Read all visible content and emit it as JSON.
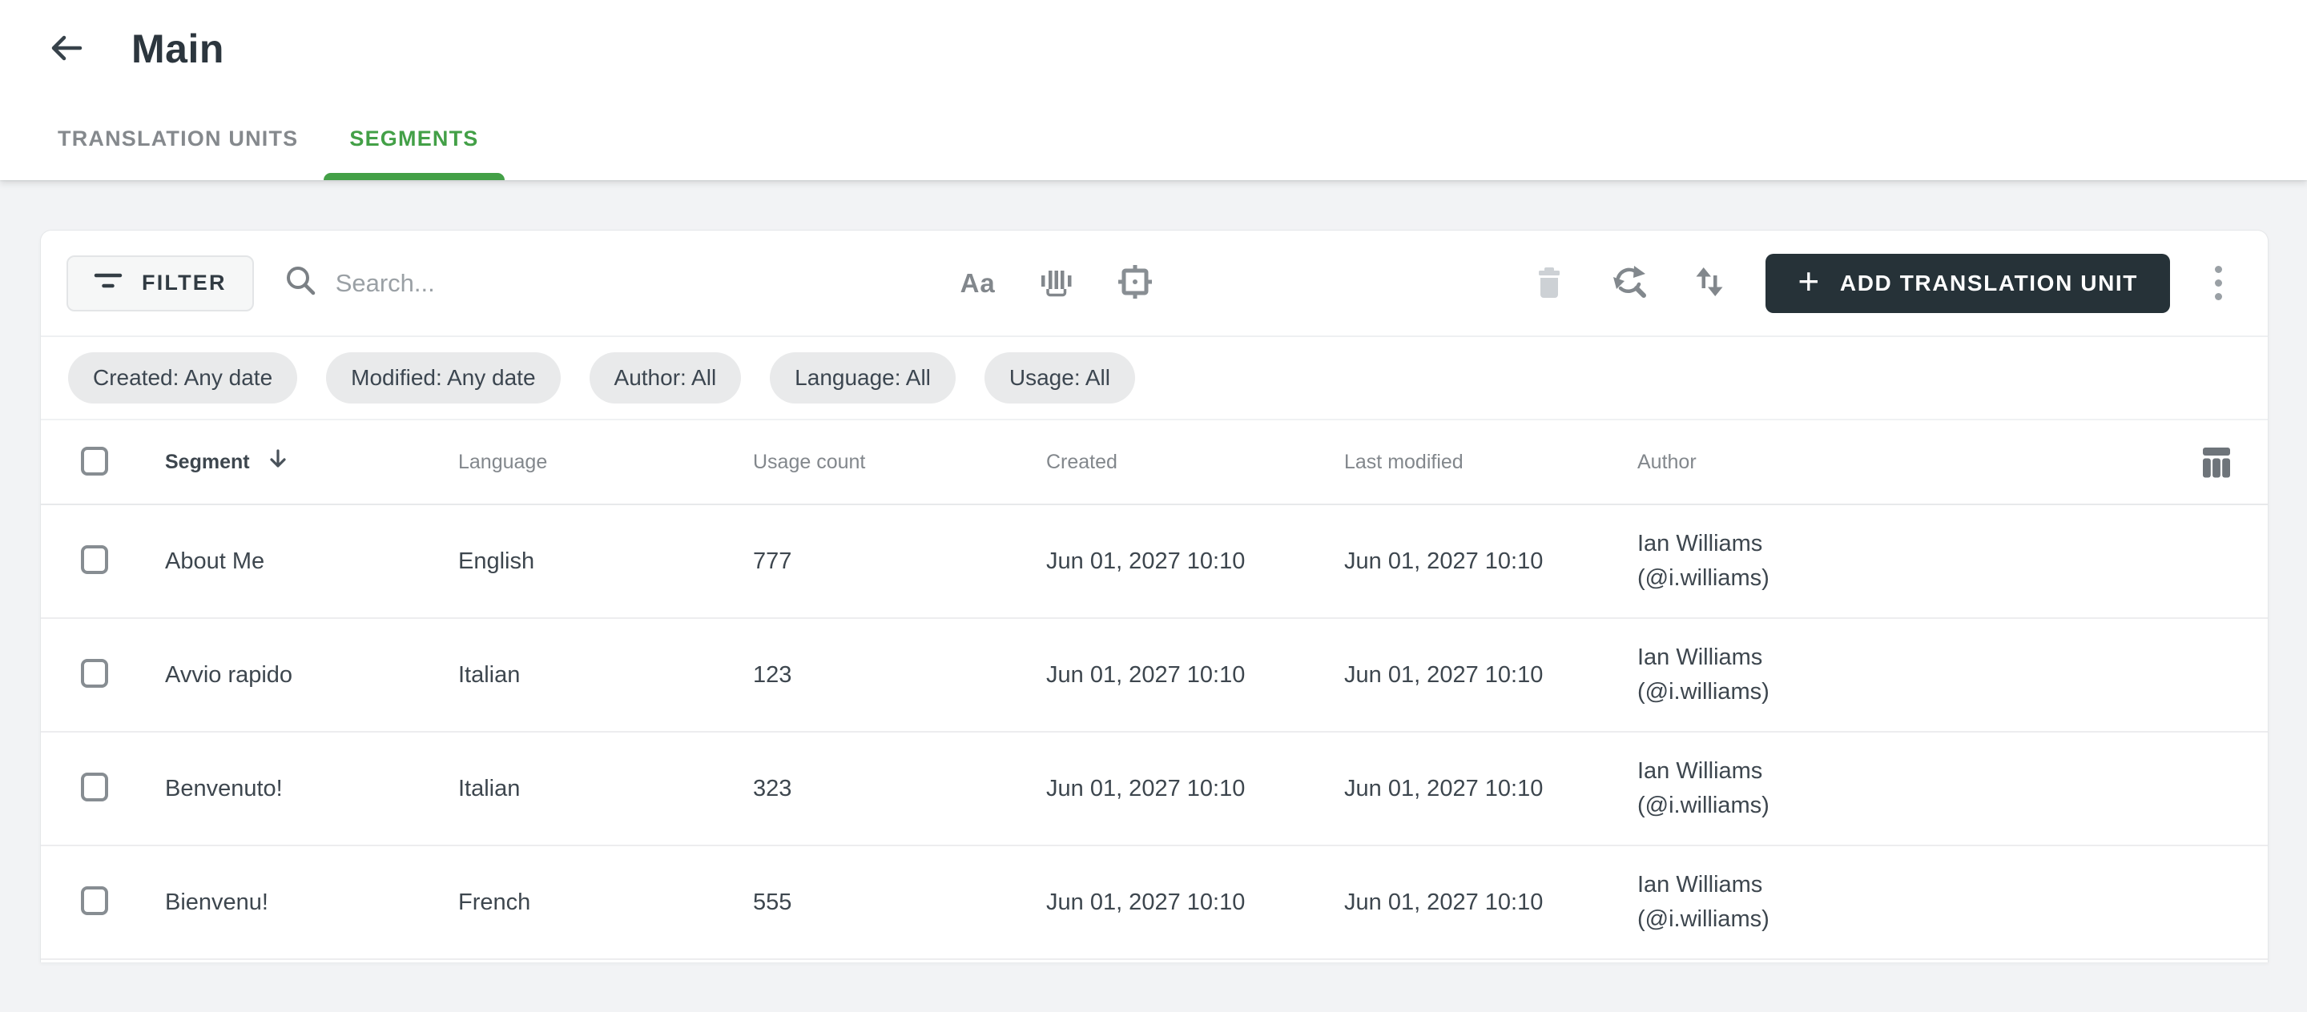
{
  "header": {
    "title": "Main"
  },
  "tabs": [
    {
      "label": "TRANSLATION UNITS",
      "active": false
    },
    {
      "label": "SEGMENTS",
      "active": true
    }
  ],
  "toolbar": {
    "filter_label": "FILTER",
    "search_placeholder": "Search...",
    "search_value": "",
    "match_case_label": "Aa",
    "add_button_label": "ADD TRANSLATION UNIT"
  },
  "filter_chips": [
    "Created: Any date",
    "Modified: Any date",
    "Author: All",
    "Language: All",
    "Usage: All"
  ],
  "table": {
    "columns": [
      "Segment",
      "Language",
      "Usage count",
      "Created",
      "Last modified",
      "Author"
    ],
    "sort": {
      "column": "Segment",
      "direction": "descending"
    },
    "rows": [
      {
        "segment": "About Me",
        "language": "English",
        "usage_count": "777",
        "created": "Jun 01, 2027 10:10",
        "last_modified": "Jun 01, 2027 10:10",
        "author_name": "Ian Williams",
        "author_handle": "(@i.williams)"
      },
      {
        "segment": "Avvio rapido",
        "language": "Italian",
        "usage_count": "123",
        "created": "Jun 01, 2027 10:10",
        "last_modified": "Jun 01, 2027 10:10",
        "author_name": "Ian Williams",
        "author_handle": "(@i.williams)"
      },
      {
        "segment": "Benvenuto!",
        "language": "Italian",
        "usage_count": "323",
        "created": "Jun 01, 2027 10:10",
        "last_modified": "Jun 01, 2027 10:10",
        "author_name": "Ian Williams",
        "author_handle": "(@i.williams)"
      },
      {
        "segment": "Bienvenu!",
        "language": "French",
        "usage_count": "555",
        "created": "Jun 01, 2027 10:10",
        "last_modified": "Jun 01, 2027 10:10",
        "author_name": "Ian Williams",
        "author_handle": "(@i.williams)"
      }
    ]
  },
  "icons": {
    "back": "arrow-left",
    "filter": "filter-lines",
    "search": "magnifier",
    "match_word": "barcode-underline",
    "exact_match": "selection-frame-dot",
    "delete": "trash",
    "find_replace": "refresh-magnifier",
    "sort": "swap-vertical",
    "add": "plus",
    "more": "vertical-dots",
    "column_settings": "table-columns",
    "sort_indicator": "arrow-down"
  },
  "colors": {
    "accent_green": "#43a047",
    "dark_text": "#2c363e",
    "button_bg": "#263238",
    "chip_bg": "#e9eaeb",
    "page_bg": "#f2f3f5",
    "disabled_icon": "#cdd1d5"
  }
}
